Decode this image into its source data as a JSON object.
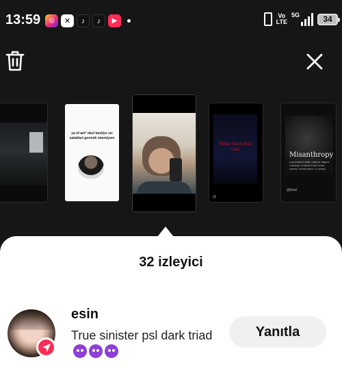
{
  "status_bar": {
    "time": "13:59",
    "app_icons": [
      "instagram-icon",
      "capcut-icon",
      "tiktok-icon",
      "tiktok-icon",
      "video-app-icon"
    ],
    "network_top": "Vo",
    "network_bottom": "LTE",
    "network_gen": "5G",
    "battery": "34"
  },
  "top_actions": {
    "delete_icon": "trash-icon",
    "close_icon": "close-icon"
  },
  "stories": {
    "thumb2_text": "ya of am* okul basliyo siz sataklari gormek istemiyom",
    "thumb4_text": "Make them feel that",
    "thumb4_handle": "@",
    "thumb5_title": "Misanthropy",
    "thumb5_subtitle": "a generalized dislike, distrust, disgust, contempt, or hatred of the human species, human nature, or society.",
    "thumb5_handle": "@fund"
  },
  "sheet": {
    "viewer_count": "32 izleyici",
    "viewers": [
      {
        "name": "esin",
        "message": "True sinister psl dark triad",
        "emoji_count": 3,
        "reply_label": "Yanıtla"
      }
    ]
  },
  "colors": {
    "background": "#161616",
    "sheet": "#ffffff",
    "badge": "#fe2c55",
    "reply_button": "#f0f0f0"
  }
}
